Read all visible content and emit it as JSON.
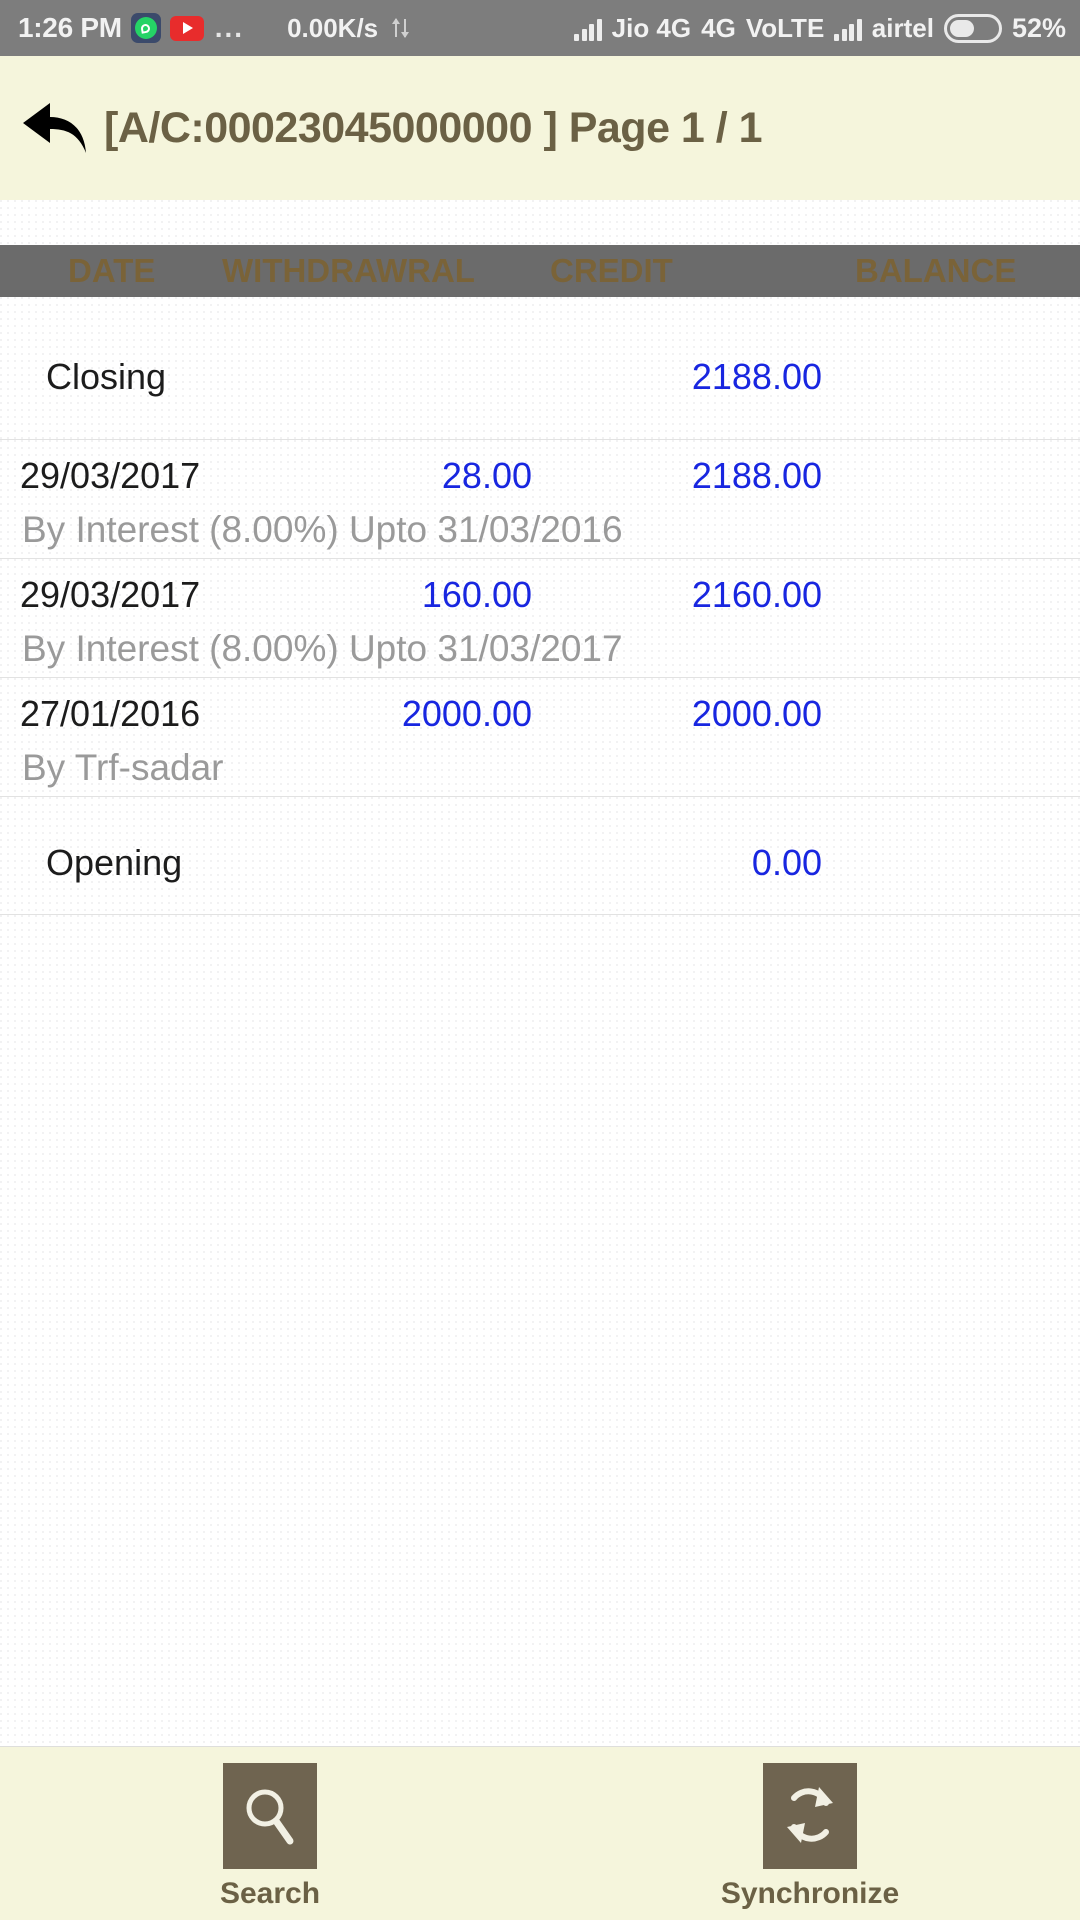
{
  "status_bar": {
    "clock": "1:26 PM",
    "whatsapp_icon": "whatsapp-icon",
    "youtube_icon": "youtube-icon",
    "overflow_dots": "...",
    "network_speed": "0.00K/s",
    "data_transfer_icon": "data-transfer-icon",
    "sim1_label": "Jio 4G",
    "network_type": "4G",
    "volte_label": "VoLTE",
    "sim2_label": "airtel",
    "battery_percent": "52%",
    "battery_level": 52
  },
  "header": {
    "back_icon": "back-arrow-icon",
    "title": "[A/C:00023045000000 ] Page 1 / 1"
  },
  "table": {
    "columns": {
      "date": "DATE",
      "withdrawal": "WITHDRAWRAL",
      "credit": "CREDIT",
      "balance": "BALANCE"
    },
    "closing": {
      "label": "Closing",
      "balance": "2188.00"
    },
    "opening": {
      "label": "Opening",
      "balance": "0.00"
    },
    "rows": [
      {
        "date": "29/03/2017",
        "withdrawal": "",
        "credit": "28.00",
        "balance": "2188.00",
        "narration": "By Interest (8.00%) Upto 31/03/2016"
      },
      {
        "date": "29/03/2017",
        "withdrawal": "",
        "credit": "160.00",
        "balance": "2160.00",
        "narration": "By Interest (8.00%) Upto 31/03/2017"
      },
      {
        "date": "27/01/2016",
        "withdrawal": "",
        "credit": "2000.00",
        "balance": "2000.00",
        "narration": "By Trf-sadar"
      }
    ]
  },
  "bottom_bar": {
    "search_label": "Search",
    "search_icon": "search-icon",
    "sync_label": "Synchronize",
    "sync_icon": "synchronize-icon"
  },
  "colors": {
    "cream": "#f5f5dc",
    "header_text": "#6b6145",
    "column_header_bg": "#6b6b6b",
    "column_header_text": "#7a6338",
    "amount_blue": "#1826e0",
    "narration_gray": "#9a9a9a",
    "icon_brown": "#6f6450",
    "status_bar_bg": "#7d7d7d"
  }
}
